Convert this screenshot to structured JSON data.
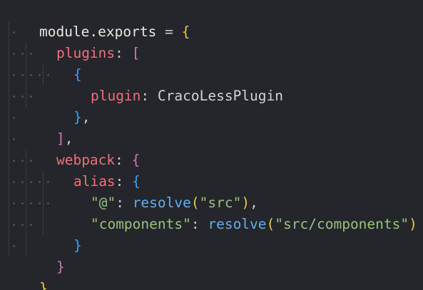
{
  "code": {
    "lines": [
      {
        "t": [
          "module.exports",
          " = ",
          "{"
        ]
      },
      {
        "t": [
          "plugins",
          ": ",
          "["
        ]
      },
      {
        "t": [
          "{"
        ]
      },
      {
        "t": [
          "plugin",
          ": ",
          "CracoLessPlugin"
        ]
      },
      {
        "t": [
          "}",
          ","
        ]
      },
      {
        "t": [
          "]",
          ","
        ]
      },
      {
        "t": [
          "webpack",
          ": ",
          "{"
        ]
      },
      {
        "t": [
          "alias",
          ": ",
          "{"
        ]
      },
      {
        "t": [
          "\"@\"",
          ": ",
          "resolve",
          "(",
          "\"src\"",
          ")",
          ","
        ]
      },
      {
        "t": [
          "\"components\"",
          ": ",
          "resolve",
          "(",
          "\"src/components\"",
          ")"
        ]
      },
      {
        "t": [
          "}"
        ]
      },
      {
        "t": [
          "}"
        ]
      },
      {
        "t": [
          "}"
        ]
      }
    ]
  },
  "colors": {
    "background": "#24262b",
    "brace_outer": "#e6c84a",
    "brace_mid": "#d971b8",
    "brace_inner": "#3fa0ee",
    "property": "#ee6f7d",
    "function": "#61afef",
    "string": "#98c379"
  }
}
